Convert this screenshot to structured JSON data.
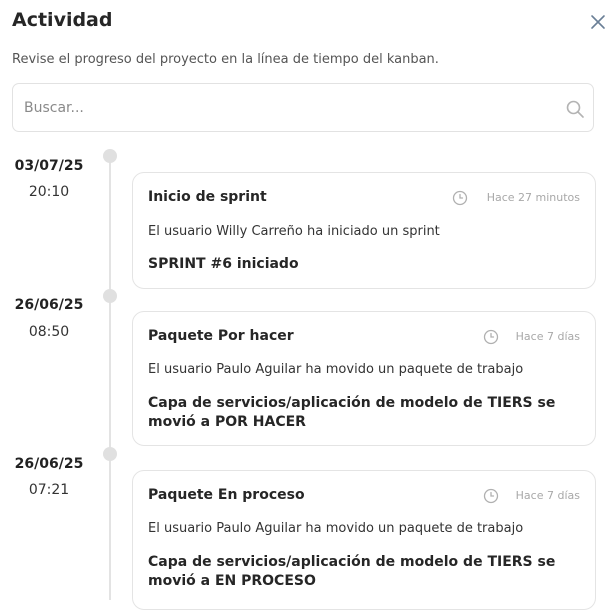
{
  "header": {
    "title": "Actividad",
    "subtitle": "Revise el progreso del proyecto en la línea de tiempo del kanban."
  },
  "search": {
    "placeholder": "Buscar..."
  },
  "entries": [
    {
      "date": "03/07/25",
      "time": "20:10",
      "title": "Inicio de sprint",
      "ago": "Hace 27 minutos",
      "description": "El usuario Willy Carreño ha iniciado un sprint",
      "detail_part1": "SPRINT #6",
      "detail_part2": " iniciado"
    },
    {
      "date": "26/06/25",
      "time": "08:50",
      "title": "Paquete Por hacer",
      "ago": "Hace 7 días",
      "description": "El usuario Paulo Aguilar ha movido un paquete de trabajo",
      "detail_part1": "Capa de servicios/aplicación de modelo de TIERS",
      "detail_part2": " se movió a POR HACER"
    },
    {
      "date": "26/06/25",
      "time": "07:21",
      "title": "Paquete En proceso",
      "ago": "Hace 7 días",
      "description": "El usuario Paulo Aguilar ha movido un paquete de trabajo",
      "detail_part1": "Capa de servicios/aplicación de modelo de TIERS",
      "detail_part2": " se movió a EN PROCESO"
    }
  ],
  "icons": {
    "close": "close-icon",
    "search": "search-icon",
    "clock": "clock-icon"
  },
  "colors": {
    "timeline": "#e3e3e3",
    "border": "#e4e4e4",
    "muted_text": "#a8a8a8"
  }
}
